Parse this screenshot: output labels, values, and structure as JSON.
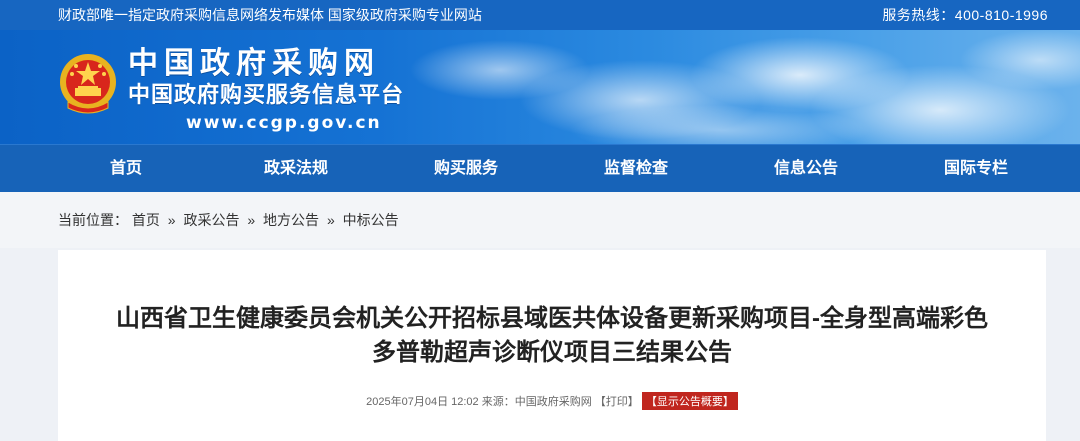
{
  "topbar": {
    "left_text": "财政部唯一指定政府采购信息网络发布媒体  国家级政府采购专业网站",
    "hotline": "服务热线：400-810-1996"
  },
  "logo": {
    "title": "中国政府采购网",
    "subtitle": "中国政府购买服务信息平台",
    "url": "www.ccgp.gov.cn"
  },
  "nav": {
    "items": [
      {
        "label": "首页"
      },
      {
        "label": "政采法规"
      },
      {
        "label": "购买服务"
      },
      {
        "label": "监督检查"
      },
      {
        "label": "信息公告"
      },
      {
        "label": "国际专栏"
      }
    ]
  },
  "breadcrumb": {
    "prefix": "当前位置：",
    "items": [
      {
        "label": "首页"
      },
      {
        "label": "政采公告"
      },
      {
        "label": "地方公告"
      },
      {
        "label": "中标公告"
      }
    ],
    "separator": "»"
  },
  "article": {
    "title_line1": "山西省卫生健康委员会机关公开招标县域医共体设备更新采购项目-全身型高端彩色",
    "title_line2": "多普勒超声诊断仪项目三结果公告",
    "date": "2025年07月04日 12:02",
    "source": "来源：中国政府采购网",
    "print_label": "【打印】",
    "summary_label": "【显示公告概要】"
  },
  "colors": {
    "topbar": "#1766c1",
    "nav": "#1763b8",
    "summary_button": "#c0261e"
  }
}
